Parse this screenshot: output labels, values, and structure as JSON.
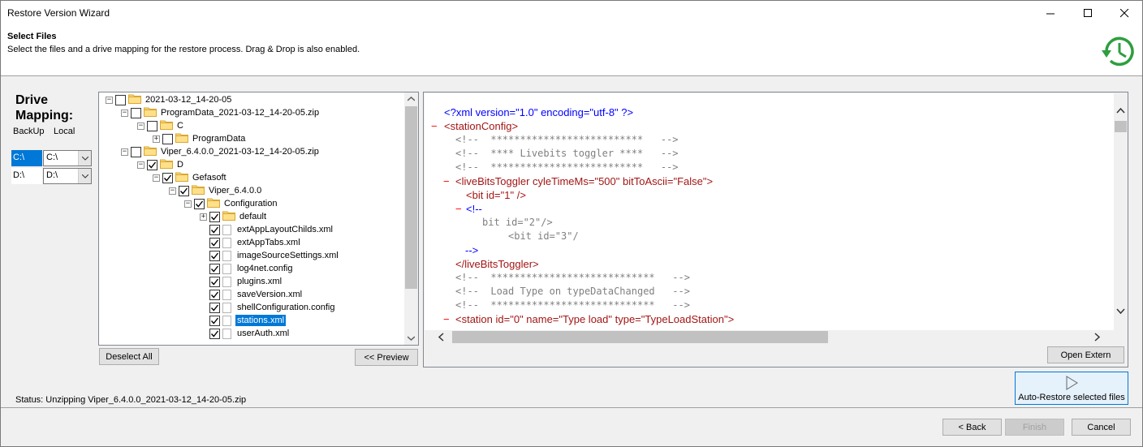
{
  "window": {
    "title": "Restore Version Wizard"
  },
  "header": {
    "title": "Select Files",
    "subtitle": "Select the files and a drive mapping for the restore process. Drag & Drop is also enabled.",
    "icon": "restore-clock-icon"
  },
  "drive_mapping": {
    "title_line1": "Drive",
    "title_line2": "Mapping:",
    "col_backup": "BackUp",
    "col_local": "Local",
    "rows": [
      {
        "backup": "C:\\",
        "local": "C:\\"
      },
      {
        "backup": "D:\\",
        "local": "D:\\"
      }
    ]
  },
  "tree": {
    "nodes": [
      {
        "label": "2021-03-12_14-20-05",
        "expander": "−",
        "checked": false,
        "type": "folder"
      },
      {
        "label": "ProgramData_2021-03-12_14-20-05.zip",
        "expander": "−",
        "checked": false,
        "type": "folder"
      },
      {
        "label": "C",
        "expander": "−",
        "checked": false,
        "type": "folder"
      },
      {
        "label": "ProgramData",
        "expander": "+",
        "checked": false,
        "type": "folder"
      },
      {
        "label": "Viper_6.4.0.0_2021-03-12_14-20-05.zip",
        "expander": "−",
        "checked": false,
        "type": "folder"
      },
      {
        "label": "D",
        "expander": "−",
        "checked": true,
        "type": "folder"
      },
      {
        "label": "Gefasoft",
        "expander": "−",
        "checked": true,
        "type": "folder"
      },
      {
        "label": "Viper_6.4.0.0",
        "expander": "−",
        "checked": true,
        "type": "folder"
      },
      {
        "label": "Configuration",
        "expander": "−",
        "checked": true,
        "type": "folder"
      },
      {
        "label": "default",
        "expander": "+",
        "checked": true,
        "type": "folder"
      },
      {
        "label": "extAppLayoutChilds.xml",
        "expander": "",
        "checked": true,
        "type": "file"
      },
      {
        "label": "extAppTabs.xml",
        "expander": "",
        "checked": true,
        "type": "file"
      },
      {
        "label": "imageSourceSettings.xml",
        "expander": "",
        "checked": true,
        "type": "file"
      },
      {
        "label": "log4net.config",
        "expander": "",
        "checked": true,
        "type": "file"
      },
      {
        "label": "plugins.xml",
        "expander": "",
        "checked": true,
        "type": "file"
      },
      {
        "label": "saveVersion.xml",
        "expander": "",
        "checked": true,
        "type": "file"
      },
      {
        "label": "shellConfiguration.config",
        "expander": "",
        "checked": true,
        "type": "file"
      },
      {
        "label": "stations.xml",
        "expander": "",
        "checked": true,
        "type": "file",
        "selected": true
      },
      {
        "label": "userAuth.xml",
        "expander": "",
        "checked": true,
        "type": "file"
      }
    ]
  },
  "buttons": {
    "deselect_all": "Deselect All",
    "preview": "<< Preview",
    "open_extern": "Open Extern",
    "auto_restore": "Auto-Restore selected files",
    "back": "< Back",
    "finish": "Finish",
    "cancel": "Cancel"
  },
  "xml_preview": {
    "lines": [
      "<?xml version=\"1.0\" encoding=\"utf-8\" ?>",
      "<stationConfig>",
      "<!--  **************************   -->",
      "<!--  **** Livebits toggler ****   -->",
      "<!--  **************************   -->",
      "<liveBitsToggler cyleTimeMs=\"500\" bitToAscii=\"False\">",
      "<bit id=\"1\" />",
      "<!--",
      "bit id=\"2\"/>",
      "<bit id=\"3\"/",
      "-->",
      "</liveBitsToggler>",
      "<!--  ****************************   -->",
      "<!--  Load Type on typeDataChanged   -->",
      "<!--  ****************************   -->",
      "<station id=\"0\" name=\"Type load\" type=\"TypeLoadStation\">"
    ]
  },
  "status": {
    "text": "Status: Unzipping Viper_6.4.0.0_2021-03-12_14-20-05.zip"
  }
}
